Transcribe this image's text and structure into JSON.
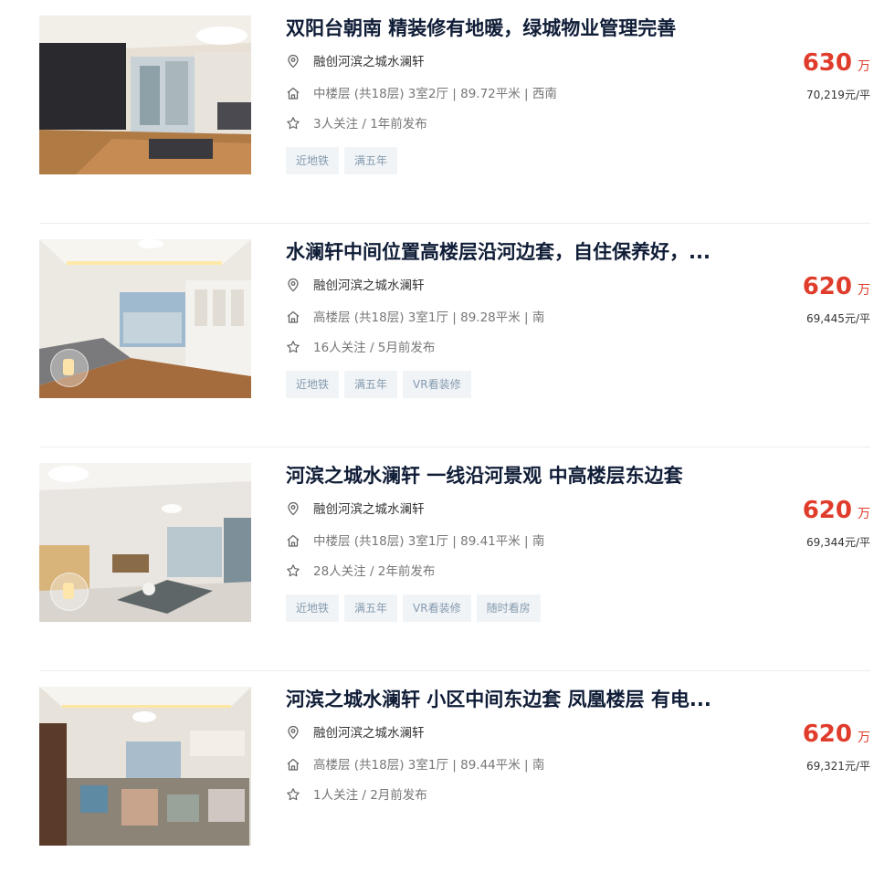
{
  "listings": [
    {
      "title": "双阳台朝南 精装修有地暖，绿城物业管理完善",
      "community": "融创河滨之城水澜轩",
      "house_info": "中楼层 (共18层) 3室2厅 | 89.72平米 | 西南",
      "follow_info": "3人关注 / 1年前发布",
      "tags": [
        "近地铁",
        "满五年"
      ],
      "price": "630",
      "price_unit": "万",
      "unit_price": "70,219元/平"
    },
    {
      "title": "水澜轩中间位置高楼层沿河边套，自住保养好，...",
      "community": "融创河滨之城水澜轩",
      "house_info": "高楼层 (共18层) 3室1厅 | 89.28平米 | 南",
      "follow_info": "16人关注 / 5月前发布",
      "tags": [
        "近地铁",
        "满五年",
        "VR看装修"
      ],
      "price": "620",
      "price_unit": "万",
      "unit_price": "69,445元/平"
    },
    {
      "title": "河滨之城水澜轩 一线沿河景观 中高楼层东边套",
      "community": "融创河滨之城水澜轩",
      "house_info": "中楼层 (共18层) 3室1厅 | 89.41平米 | 南",
      "follow_info": "28人关注 / 2年前发布",
      "tags": [
        "近地铁",
        "满五年",
        "VR看装修",
        "随时看房"
      ],
      "price": "620",
      "price_unit": "万",
      "unit_price": "69,344元/平"
    },
    {
      "title": "河滨之城水澜轩 小区中间东边套 凤凰楼层 有电...",
      "community": "融创河滨之城水澜轩",
      "house_info": "高楼层 (共18层) 3室1厅 | 89.44平米 | 南",
      "follow_info": "1人关注 / 2月前发布",
      "tags": [],
      "price": "620",
      "price_unit": "万",
      "unit_price": "69,321元/平"
    }
  ],
  "colors": {
    "title": "#101d37",
    "price": "#e03c2c",
    "tag_bg": "#f1f4f7",
    "tag_text": "#849aae"
  },
  "icons": [
    "location-pin-icon",
    "house-icon",
    "star-icon"
  ]
}
